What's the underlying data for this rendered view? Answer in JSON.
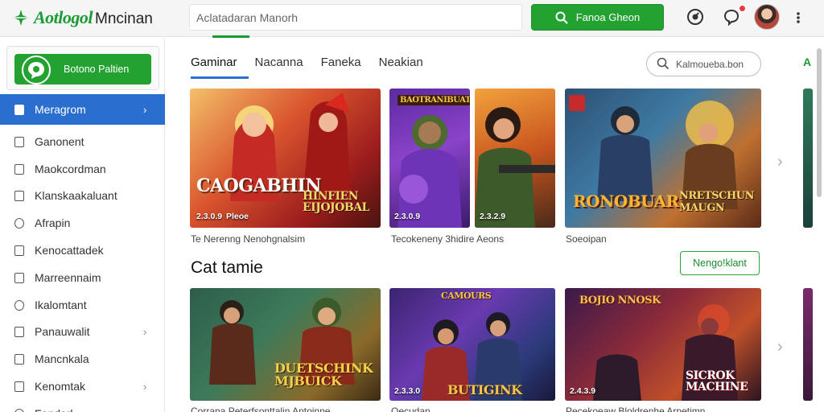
{
  "header": {
    "brand": "Aotlogol",
    "brand_sub": "Mncinan",
    "search_placeholder": "Aclatadaran Manorh",
    "primary_button": "Fanoa Gheon",
    "icons": [
      "logo-icon",
      "search-icon",
      "gauge-icon",
      "chat-bubble-icon",
      "avatar",
      "more-vertical-icon"
    ]
  },
  "sidebar": {
    "cta_label": "Botono Paltien",
    "items": [
      {
        "label": "Meragrom",
        "active": true,
        "chevron": true
      },
      {
        "label": "Ganonent",
        "active": false,
        "chevron": false
      },
      {
        "label": "Maokcordman",
        "active": false,
        "chevron": false
      },
      {
        "label": "Klanskaakaluant",
        "active": false,
        "chevron": false
      },
      {
        "label": "Afrapin",
        "active": false,
        "chevron": false
      },
      {
        "label": "Kenocattadek",
        "active": false,
        "chevron": false
      },
      {
        "label": "Marreennaim",
        "active": false,
        "chevron": false
      },
      {
        "label": "Ikalomtant",
        "active": false,
        "chevron": false
      },
      {
        "label": "Panauwalit",
        "active": false,
        "chevron": true
      },
      {
        "label": "Mancnkala",
        "active": false,
        "chevron": false
      },
      {
        "label": "Kenomtak",
        "active": false,
        "chevron": true
      },
      {
        "label": "Fandarl",
        "active": false,
        "chevron": true
      }
    ]
  },
  "main": {
    "tabs": [
      "Gaminar",
      "Nacanna",
      "Faneka",
      "Neakian"
    ],
    "active_tab": "Gaminar",
    "filter_placeholder": "Kalmoueba.bon",
    "edge_letter": "A",
    "row1": [
      {
        "title_a": "CAOGABHIN",
        "title_b": "HINFIEN\nEIJOJOBAL",
        "number": "2.3.0.9",
        "extra": "Pleoe",
        "caption": "Te Nerenng Nenohgnalsim"
      },
      {
        "title_a": "BAOTRANIBUAT",
        "number": "2.3.0.9",
        "caption": ""
      },
      {
        "title_a": "",
        "number": "2.3.2.9",
        "caption": "Tecokeneny 3hidire Aeons"
      },
      {
        "title_a": "RONOBUAR",
        "title_b": "NRETSCHUN\nMAUGN",
        "number": "",
        "caption": "Soeoipan"
      }
    ],
    "section_title": "Cat tamie",
    "section_button": "Nengo!klant",
    "row2": [
      {
        "title_a": "DUETSCHINK\nMJBUICK",
        "number": "",
        "caption": "Corrana Peterfsonttalin Antoinne"
      },
      {
        "title_a": "CAMOURS",
        "title_b": "BUTIGINK",
        "number": "2.3.3.0",
        "caption": "Oecudan"
      },
      {
        "title_a": "BOJIO NNOSK",
        "title_b": "SICROK\nMACHINE",
        "number": "2.4.3.9",
        "caption": "Pecekoeaw Bloldrenhe Arpetimn"
      }
    ]
  }
}
